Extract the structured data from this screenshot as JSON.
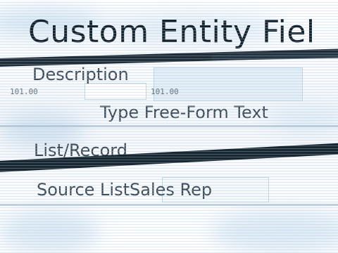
{
  "heading": {
    "title": "Custom Entity Fiel"
  },
  "fields": {
    "description_label": "Description",
    "type_label": "Type Free-Form Text",
    "list_record_label": "List/Record",
    "source_list_label": "Source List",
    "source_list_value": "Sales Rep"
  },
  "small_values": {
    "left": "101.00",
    "right": "101.00"
  },
  "colors": {
    "accent_blue": "#b7d3ea",
    "streak": "#0d1b26",
    "text": "#17232c"
  }
}
